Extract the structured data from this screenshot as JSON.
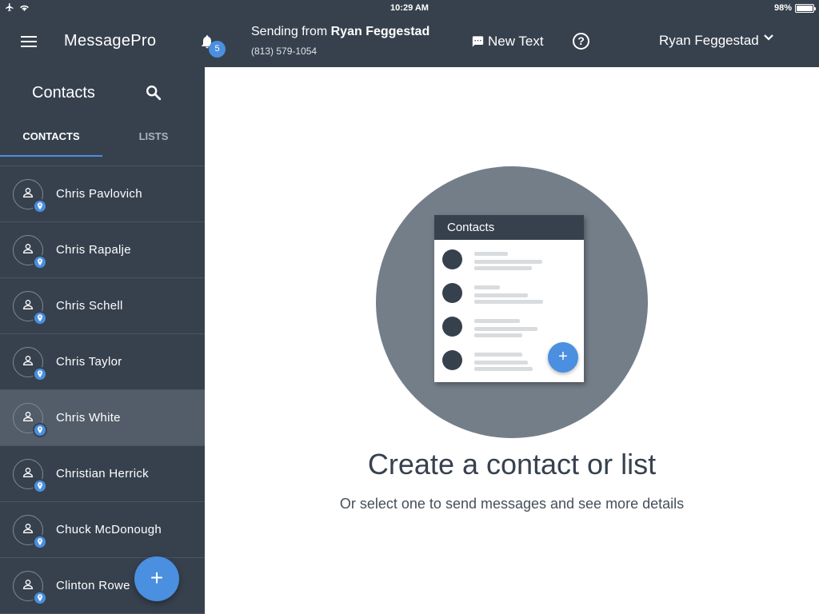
{
  "status_bar": {
    "time": "10:29 AM",
    "battery": "98%",
    "battery_level": 0.98
  },
  "header": {
    "app_title": "MessagePro",
    "notification_count": "5",
    "sending_prefix": "Sending from",
    "sending_name": "Ryan Feggestad",
    "phone": "(813) 579-1054",
    "new_text_label": "New Text",
    "help_glyph": "?",
    "user_name": "Ryan Feggestad"
  },
  "sidebar": {
    "title": "Contacts",
    "tabs": [
      {
        "label": "CONTACTS"
      },
      {
        "label": "LISTS"
      }
    ],
    "contacts": [
      {
        "name": "Chris Pavlovich"
      },
      {
        "name": "Chris Rapalje"
      },
      {
        "name": "Chris Schell"
      },
      {
        "name": "Chris Taylor"
      },
      {
        "name": "Chris White"
      },
      {
        "name": "Christian Herrick"
      },
      {
        "name": "Chuck McDonough"
      },
      {
        "name": "Clinton Rowe"
      }
    ],
    "selected_contact": "Chris White",
    "fab_label": "+"
  },
  "main": {
    "illustration_card_title": "Contacts",
    "illustration_fab": "+",
    "empty_title": "Create a contact or list",
    "empty_subtitle": "Or select one to send messages and see more details"
  },
  "colors": {
    "header_bg": "#37414e",
    "accent": "#4a8fe0",
    "selected_row": "#535d69",
    "illustration_circle": "#747e89"
  },
  "icons": [
    "airplane-icon",
    "wifi-icon",
    "battery-icon",
    "menu-icon",
    "bell-icon",
    "chat-icon",
    "help-icon",
    "chevron-down-icon",
    "search-icon",
    "person-icon",
    "location-pin-icon",
    "add-icon"
  ]
}
